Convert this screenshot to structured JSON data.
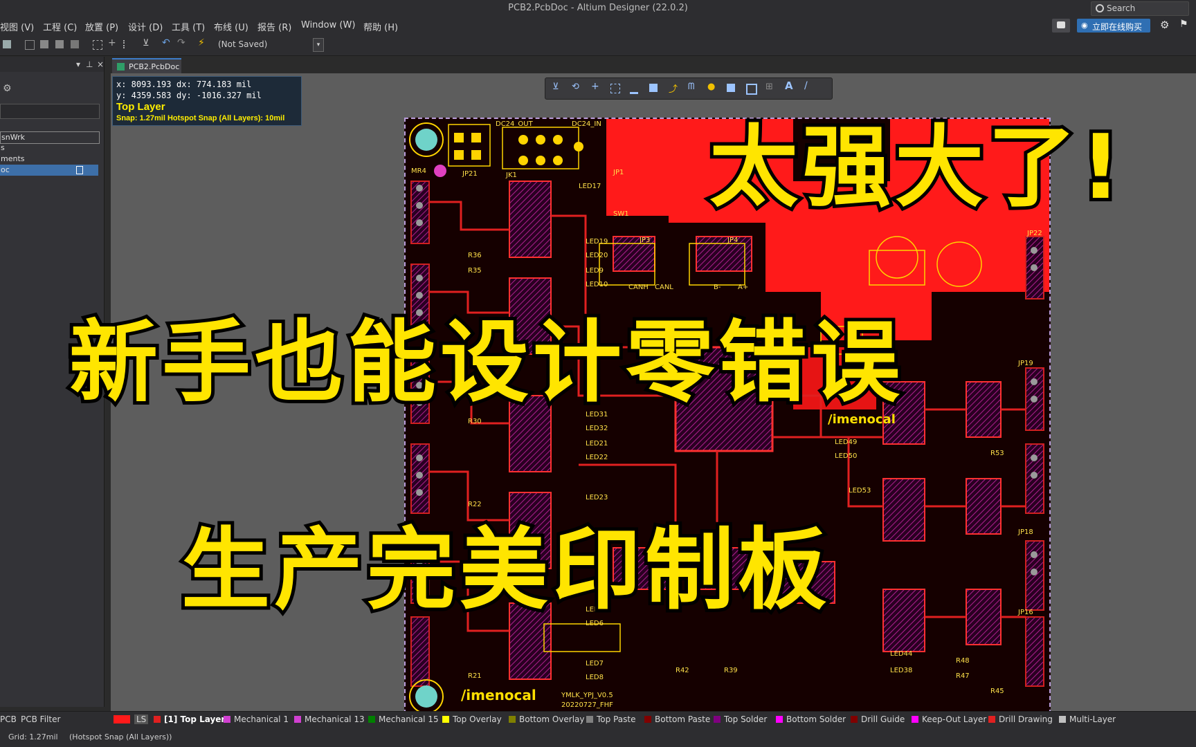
{
  "window": {
    "title": "PCB2.PcbDoc - Altium Designer (22.0.2)"
  },
  "search": {
    "label": "Search"
  },
  "menu": {
    "items": [
      "视图 (V)",
      "工程 (C)",
      "放置 (P)",
      "设计 (D)",
      "工具 (T)",
      "布线 (U)",
      "报告 (R)",
      "Window (W)",
      "帮助 (H)"
    ]
  },
  "menu_right": {
    "buy_label": "立即在线购买"
  },
  "toolbar": {
    "status": "(Not Saved)"
  },
  "left_panel": {
    "items": [
      "snWrk",
      "s",
      "ments",
      "oc"
    ],
    "bottom_tabs": [
      "PCB",
      "PCB Filter"
    ]
  },
  "document_tab": {
    "label": "PCB2.PcbDoc"
  },
  "hud": {
    "x": "x:  8093.193",
    "dx": "dx:   774.183  mil",
    "y": "y:  4359.583",
    "dy": "dy: -1016.327  mil",
    "layer": "Top Layer",
    "snap": "Snap: 1.27mil Hotspot Snap (All Layers): 10mil"
  },
  "overlay": {
    "line1": "太强大了!",
    "line2": "新手也能设计零错误",
    "line3": "生产完美印制板"
  },
  "layers": {
    "ls": "LS",
    "tabs": [
      {
        "label": "[1] Top Layer",
        "color": "#e02020"
      },
      {
        "label": "Mechanical 1",
        "color": "#d040d0"
      },
      {
        "label": "Mechanical 13",
        "color": "#d040d0"
      },
      {
        "label": "Mechanical 15",
        "color": "#008000"
      },
      {
        "label": "Top Overlay",
        "color": "#ffff00"
      },
      {
        "label": "Bottom Overlay",
        "color": "#808000"
      },
      {
        "label": "Top Paste",
        "color": "#808080"
      },
      {
        "label": "Bottom Paste",
        "color": "#800000"
      },
      {
        "label": "Top Solder",
        "color": "#800080"
      },
      {
        "label": "Bottom Solder",
        "color": "#ff00ff"
      },
      {
        "label": "Drill Guide",
        "color": "#800000"
      },
      {
        "label": "Keep-Out Layer",
        "color": "#ff00ff"
      },
      {
        "label": "Drill Drawing",
        "color": "#e02020"
      },
      {
        "label": "Multi-Layer",
        "color": "#c0c0c0"
      }
    ]
  },
  "status": {
    "grid": "Grid: 1.27mil",
    "snap": "(Hotspot Snap (All Layers))"
  },
  "pcb_labels": [
    "MR4",
    "JP21",
    "JK1",
    "DC24_OUT",
    "DC24_IN",
    "JP1",
    "SW1",
    "LED17",
    "LED19",
    "LED20",
    "LED9",
    "LED10",
    "JP3",
    "JP4",
    "CANH",
    "CANL",
    "B-",
    "A+",
    "LED31",
    "LED32",
    "LED21",
    "LED22",
    "LED23",
    "LED8",
    "LED6",
    "LED7",
    "LED8",
    "JP22",
    "JP19",
    "JP18",
    "JP16",
    "LED49",
    "LED50",
    "LED53",
    "LED44",
    "LED38",
    "R53",
    "R48",
    "R47",
    "R45",
    "R42",
    "R39",
    "R21",
    "R22",
    "R30",
    "R36",
    "R35",
    "YMLK_YPJ_V0.5",
    "20220727_FHF"
  ]
}
